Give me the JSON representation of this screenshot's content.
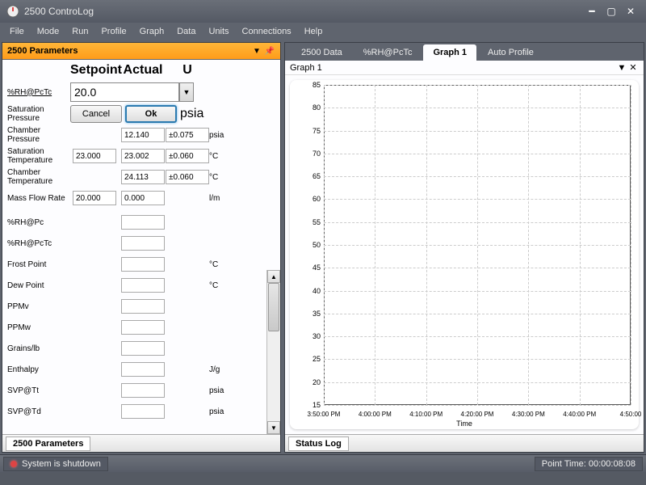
{
  "window": {
    "title": "2500 ControLog",
    "menus": [
      "File",
      "Mode",
      "Run",
      "Profile",
      "Graph",
      "Data",
      "Units",
      "Connections",
      "Help"
    ]
  },
  "left_panel": {
    "header": "2500 Parameters",
    "columns": {
      "setpoint": "Setpoint",
      "actual": "Actual",
      "u": "U"
    },
    "edit": {
      "label": "%RH@PcTc",
      "value": "20.0",
      "cancel": "Cancel",
      "ok": "Ok",
      "unit_right": "psia",
      "below_label": "Saturation Pressure"
    },
    "rows_top": [
      {
        "label": "Chamber Pressure",
        "sp": "",
        "act": "12.140",
        "u": "±0.075",
        "unit": "psia"
      },
      {
        "label": "Saturation Temperature",
        "sp": "23.000",
        "act": "23.002",
        "u": "±0.060",
        "unit": "°C"
      },
      {
        "label": "Chamber Temperature",
        "sp": "",
        "act": "24.113",
        "u": "±0.060",
        "unit": "°C"
      },
      {
        "label": "Mass Flow Rate",
        "sp": "20.000",
        "act": "0.000",
        "u": "",
        "unit": "l/m"
      }
    ],
    "rows_list": [
      {
        "label": "%RH@Pc",
        "unit": ""
      },
      {
        "label": "%RH@PcTc",
        "unit": ""
      },
      {
        "label": "Frost Point",
        "unit": "°C"
      },
      {
        "label": "Dew Point",
        "unit": "°C"
      },
      {
        "label": "PPMv",
        "unit": ""
      },
      {
        "label": "PPMw",
        "unit": ""
      },
      {
        "label": "Grains/lb",
        "unit": ""
      },
      {
        "label": "Enthalpy",
        "unit": "J/g"
      },
      {
        "label": "SVP@Tt",
        "unit": "psia"
      },
      {
        "label": "SVP@Td",
        "unit": "psia"
      }
    ],
    "footer_tab": "2500 Parameters"
  },
  "right_panel": {
    "tabs": [
      "2500 Data",
      "%RH@PcTc",
      "Graph 1",
      "Auto Profile"
    ],
    "active_tab": 2,
    "graph_header": "Graph 1"
  },
  "chart_data": {
    "type": "line",
    "title": "",
    "series": [],
    "xlabel": "Time",
    "ylabel": "",
    "y_ticks": [
      15,
      20,
      25,
      30,
      35,
      40,
      45,
      50,
      55,
      60,
      65,
      70,
      75,
      80,
      85
    ],
    "x_ticks": [
      "3:50:00 PM",
      "4:00:00 PM",
      "4:10:00 PM",
      "4:20:00 PM",
      "4:30:00 PM",
      "4:40:00 PM",
      "4:50:00"
    ],
    "ylim": [
      15,
      85
    ]
  },
  "status_footer_tab": "Status Log",
  "statusbar": {
    "system": "System is shutdown",
    "point_time_label": "Point Time:",
    "point_time_value": "00:00:08:08"
  }
}
